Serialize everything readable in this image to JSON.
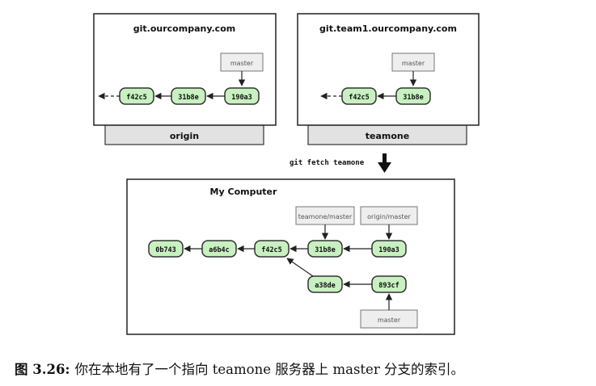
{
  "servers": [
    {
      "title": "git.ourcompany.com",
      "label": "origin",
      "commits": [
        "f42c5",
        "31b8e",
        "190a3"
      ],
      "branch": "master"
    },
    {
      "title": "git.team1.ourcompany.com",
      "label": "teamone",
      "commits": [
        "f42c5",
        "31b8e"
      ],
      "branch": "master"
    }
  ],
  "fetch_command": "git fetch teamone",
  "local": {
    "title": "My Computer",
    "commits": [
      "0b743",
      "a6b4c",
      "f42c5",
      "31b8e",
      "190a3",
      "a38de",
      "893cf"
    ],
    "branches": {
      "teamone": "teamone/master",
      "origin": "origin/master",
      "master": "master"
    }
  },
  "caption": {
    "label": "图 3.26:",
    "text": "你在本地有了一个指向 teamone 服务器上 master 分支的索引。"
  },
  "colors": {
    "commit_fill": "#c8f0c0",
    "commit_stroke": "#333333",
    "branch_fill": "#eeeeee",
    "label_fill": "#e2e2e2"
  }
}
